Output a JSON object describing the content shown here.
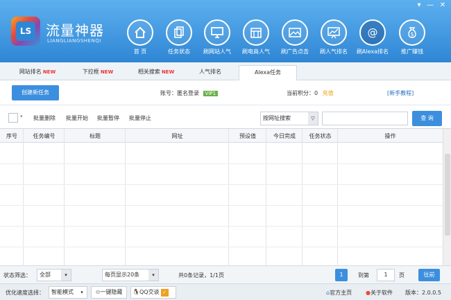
{
  "app": {
    "title": "流量神器",
    "subtitle": "LIANGLIANGSHENQI",
    "logo_letters": "LS"
  },
  "window_controls": [
    "▾",
    "—",
    "✕"
  ],
  "nav": [
    {
      "label": "首 页",
      "icon": "home-icon"
    },
    {
      "label": "任务状态",
      "icon": "documents-icon"
    },
    {
      "label": "刷网站人气",
      "icon": "monitor-icon"
    },
    {
      "label": "刷电商人气",
      "icon": "store-icon"
    },
    {
      "label": "刷广告点击",
      "icon": "image-icon"
    },
    {
      "label": "刷人气排名",
      "icon": "chart-board-icon"
    },
    {
      "label": "刷Alexa排名",
      "icon": "at-icon"
    },
    {
      "label": "推广赚钱",
      "icon": "money-bag-icon"
    }
  ],
  "tabs": [
    {
      "label": "网站排名",
      "badge": "NEW"
    },
    {
      "label": "下拉框",
      "badge": "NEW"
    },
    {
      "label": "相关搜索",
      "badge": "NEW"
    },
    {
      "label": "人气排名",
      "badge": ""
    },
    {
      "label": "Alexa任务",
      "badge": ""
    }
  ],
  "account": {
    "create_button": "创建新任务",
    "account_label": "账号：",
    "account_value": "匿名登录",
    "vip_badge": "VIP1",
    "points_label": "当前积分：",
    "points_value": "0",
    "recharge": "充值",
    "tutorial": "[新手教程]"
  },
  "toolbar": {
    "batch_delete": "批量删除",
    "batch_start": "批量开始",
    "batch_pause": "批量暂停",
    "batch_stop": "批量停止",
    "search_type": "按网址搜索",
    "search_placeholder": "",
    "search_button": "查 询"
  },
  "table": {
    "columns": [
      "序号",
      "任务编号",
      "标题",
      "网址",
      "预设值",
      "今日完成",
      "任务状态",
      "操作"
    ],
    "rows": []
  },
  "footer": {
    "status_filter_label": "状态筛选：",
    "status_filter_value": "全部",
    "page_size_value": "每页显示20条",
    "summary": "共0条记录，1/1页",
    "current_page": "1",
    "goto_label": "到第",
    "goto_value": "1",
    "page_unit": "页",
    "go_button": "往前"
  },
  "statusbar": {
    "speed_label": "优化速度选择：",
    "speed_value": "智能模式",
    "hide_button": "一键隐藏",
    "qq_button": "QQ交谈",
    "homepage": "官方主页",
    "about": "关于软件",
    "version": "版本：2.0.0.5"
  }
}
